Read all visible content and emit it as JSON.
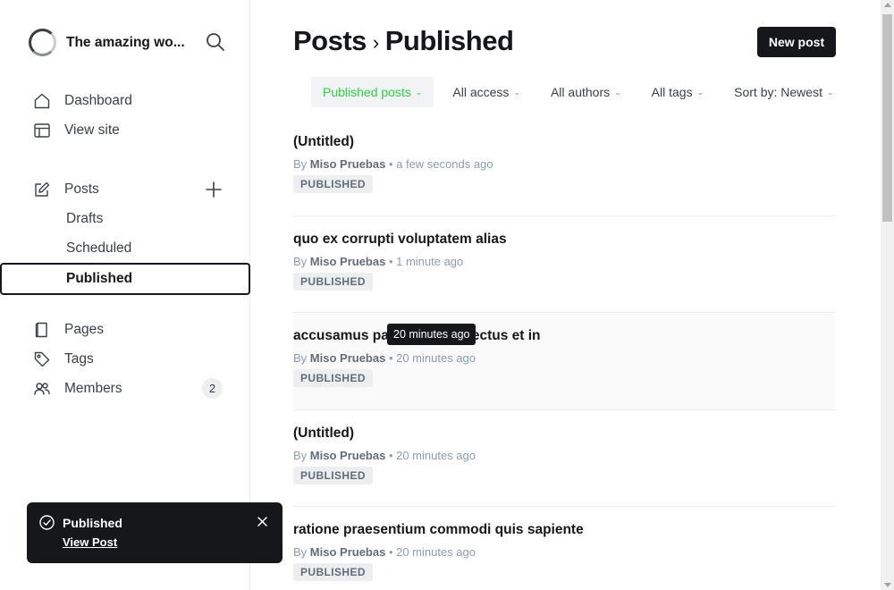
{
  "sidebar": {
    "site_title": "The amazing wo...",
    "primary": [
      {
        "label": "Dashboard",
        "icon": "home-icon"
      },
      {
        "label": "View site",
        "icon": "layout-icon"
      }
    ],
    "posts": {
      "label": "Posts",
      "icon": "edit-icon",
      "sub_items": [
        "Drafts",
        "Scheduled",
        "Published"
      ],
      "active_sub": "Published"
    },
    "secondary": [
      {
        "label": "Pages",
        "icon": "page-icon"
      },
      {
        "label": "Tags",
        "icon": "tag-icon"
      },
      {
        "label": "Members",
        "icon": "members-icon",
        "count": "2"
      }
    ]
  },
  "header": {
    "title": "Posts",
    "separator": "›",
    "subtitle": "Published",
    "new_post_label": "New post"
  },
  "filters": [
    {
      "label": "Published posts",
      "active": true
    },
    {
      "label": "All access",
      "active": false
    },
    {
      "label": "All authors",
      "active": false
    },
    {
      "label": "All tags",
      "active": false
    },
    {
      "label": "Sort by: Newest",
      "active": false
    }
  ],
  "posts": [
    {
      "title": "(Untitled)",
      "by": "By",
      "author": "Miso Pruebas",
      "time": "a few seconds ago",
      "status": "PUBLISHED"
    },
    {
      "title": "quo ex corrupti voluptatem alias",
      "by": "By",
      "author": "Miso Pruebas",
      "time": "1 minute ago",
      "status": "PUBLISHED"
    },
    {
      "title": "accusamus pariatur est delectus et in",
      "by": "By",
      "author": "Miso Pruebas",
      "time": "20 minutes ago",
      "status": "PUBLISHED"
    },
    {
      "title": "(Untitled)",
      "by": "By",
      "author": "Miso Pruebas",
      "time": "20 minutes ago",
      "status": "PUBLISHED"
    },
    {
      "title": "ratione praesentium commodi quis sapiente",
      "by": "By",
      "author": "Miso Pruebas",
      "time": "20 minutes ago",
      "status": "PUBLISHED"
    }
  ],
  "tooltip": "20 minutes ago",
  "toast": {
    "title": "Published",
    "link": "View Post"
  },
  "colors": {
    "accent_green": "#30cf43",
    "dark": "#15171a"
  }
}
